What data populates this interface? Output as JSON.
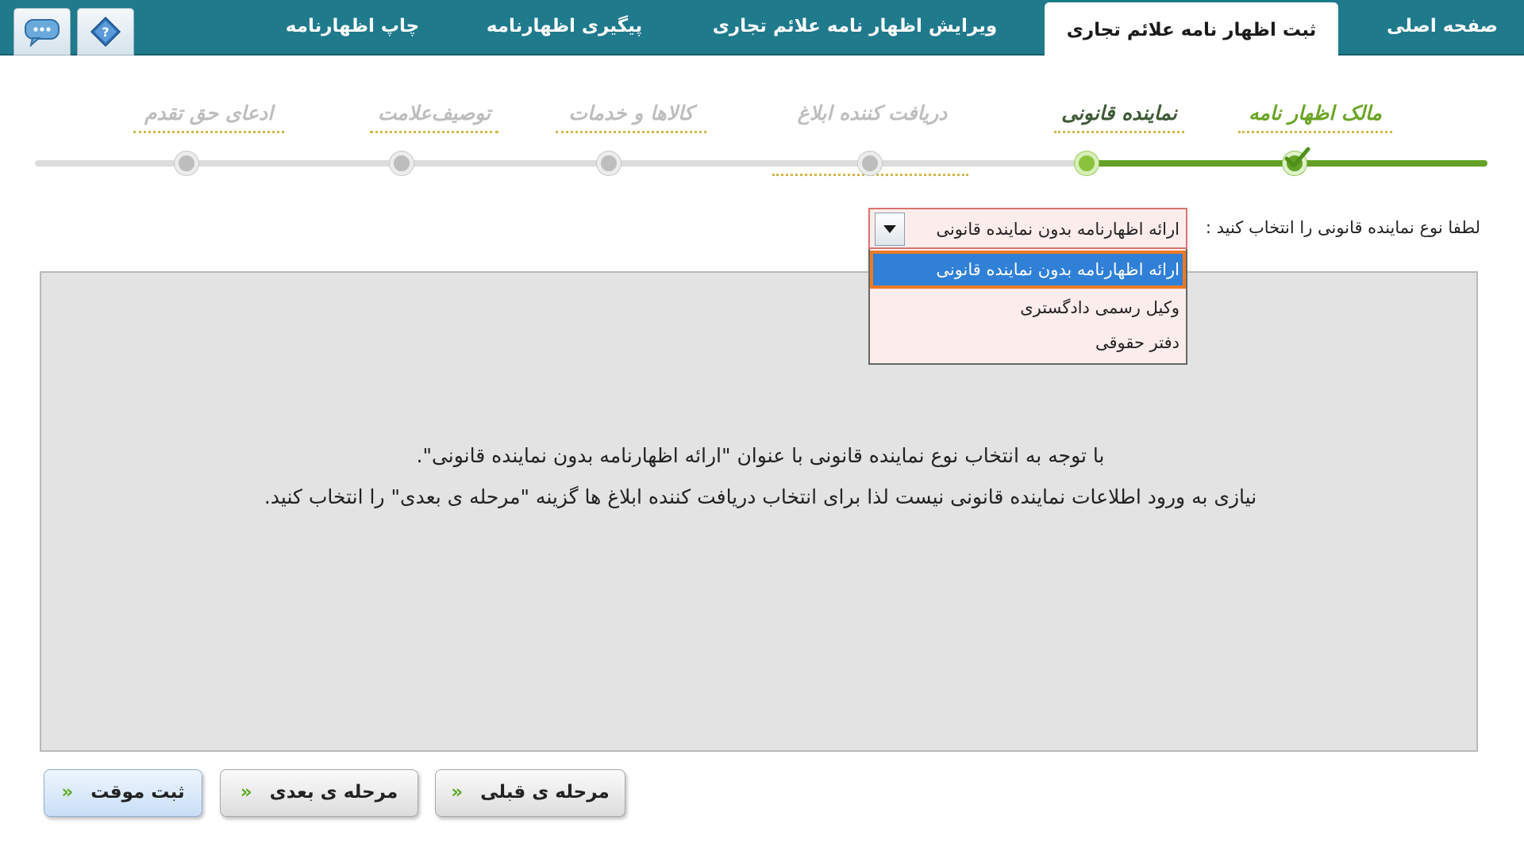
{
  "nav": {
    "tabs": [
      {
        "label": "صفحه اصلی"
      },
      {
        "label": "ثبت اظهار نامه علائم تجاری"
      },
      {
        "label": "ویرایش اظهار نامه علائم تجاری"
      },
      {
        "label": "پیگیری اظهارنامه"
      },
      {
        "label": "چاپ اظهارنامه"
      }
    ],
    "active_tab": 1,
    "icons": [
      "help-icon",
      "chat-icon"
    ]
  },
  "wizard": {
    "steps": [
      {
        "label": "مالک اظهار نامه",
        "state": "done"
      },
      {
        "label": "نماینده قانونی",
        "state": "current"
      },
      {
        "label": "دریافت کننده ابلاغ",
        "state": "pending"
      },
      {
        "label": "کالاها و خدمات",
        "state": "pending"
      },
      {
        "label": "توصیف‌علامت",
        "state": "pending"
      },
      {
        "label": "ادعای حق تقدم",
        "state": "pending"
      }
    ]
  },
  "selector": {
    "label": "لطفا نوع نماینده قانونی را انتخاب کنید :",
    "value": "ارائه اظهارنامه بدون نماینده قانونی",
    "options": [
      "ارائه اظهارنامه بدون نماینده قانونی",
      "وکیل رسمی دادگستری",
      "دفتر حقوقی"
    ]
  },
  "panel": {
    "line1": "با توجه به انتخاب نوع نماینده قانونی با عنوان \"ارائه اظهارنامه بدون نماینده قانونی\".",
    "line2": "نیازی به ورود اطلاعات نماینده قانونی نیست لذا برای انتخاب دریافت کننده ابلاغ ها گزینه \"مرحله ی بعدی\" را انتخاب کنید."
  },
  "buttons": {
    "prev": "مرحله ی قبلی",
    "next": "مرحله ی بعدی",
    "save": "ثبت موقت",
    "chevron": "«"
  },
  "colors": {
    "nav_bg": "#1f7a8c",
    "progress_green": "#62a125",
    "dropdown_bg": "#fdecec",
    "highlight": "#2f80d6",
    "highlight_outline": "#f07a23"
  }
}
